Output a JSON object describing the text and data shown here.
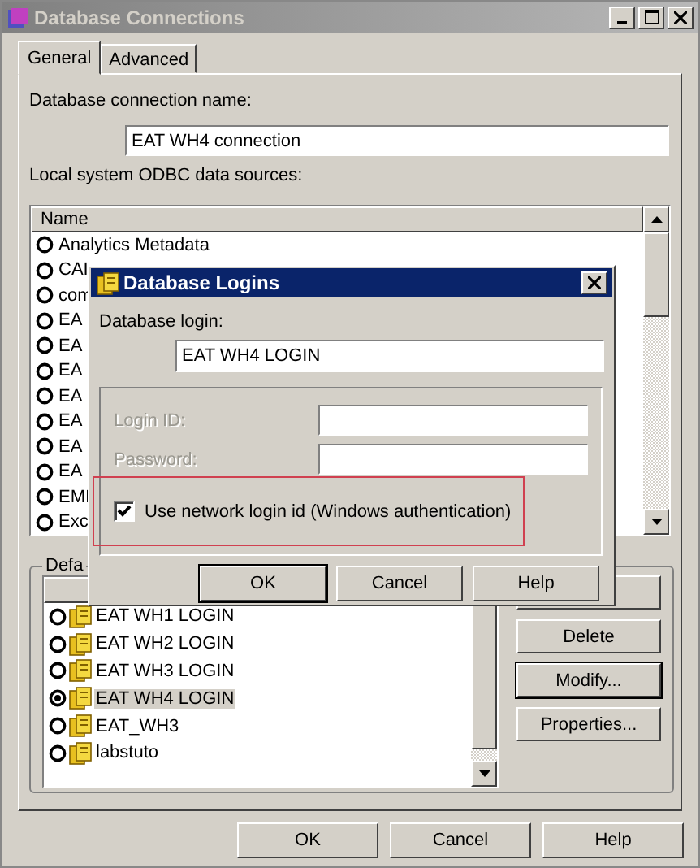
{
  "window": {
    "title": "Database Connections"
  },
  "tabs": [
    {
      "label": "General",
      "selected": true
    },
    {
      "label": "Advanced",
      "selected": false
    }
  ],
  "connection_name": {
    "label": "Database connection name:",
    "value": "EAT WH4 connection"
  },
  "odbc_sources": {
    "label": "Local system ODBC data sources:",
    "column": "Name",
    "items": [
      {
        "name": "Analytics  Metadata",
        "selected": false
      },
      {
        "name": "CAI",
        "selected": false
      },
      {
        "name": "com",
        "selected": false
      },
      {
        "name": "EA",
        "selected": false
      },
      {
        "name": "EA",
        "selected": false
      },
      {
        "name": "EA",
        "selected": false
      },
      {
        "name": "EA",
        "selected": false
      },
      {
        "name": "EA",
        "selected": false
      },
      {
        "name": "EA",
        "selected": false
      },
      {
        "name": "EA",
        "selected": false
      },
      {
        "name": "EMI",
        "selected": false
      },
      {
        "name": "Exc",
        "selected": false
      }
    ]
  },
  "default_login": {
    "legend": "Defa",
    "items": [
      {
        "name": "EAT WH1 LOGIN",
        "selected": false
      },
      {
        "name": "EAT WH2 LOGIN",
        "selected": false
      },
      {
        "name": "EAT WH3 LOGIN",
        "selected": false
      },
      {
        "name": "EAT WH4 LOGIN",
        "selected": true
      },
      {
        "name": "EAT_WH3",
        "selected": false
      },
      {
        "name": "labstuto",
        "selected": false
      }
    ],
    "buttons": [
      "Delete",
      "Modify...",
      "Properties..."
    ]
  },
  "buttons": [
    "OK",
    "Cancel",
    "Help"
  ],
  "dialog": {
    "title": "Database Logins",
    "login_label": "Database login:",
    "login_value": "EAT WH4 LOGIN",
    "fields": [
      {
        "label": "Login ID:",
        "disabled": true
      },
      {
        "label": "Password:",
        "disabled": true
      }
    ],
    "network_login": {
      "label": "Use network login id (Windows authentication)",
      "checked": true
    },
    "buttons": [
      "OK",
      "Cancel",
      "Help"
    ]
  }
}
